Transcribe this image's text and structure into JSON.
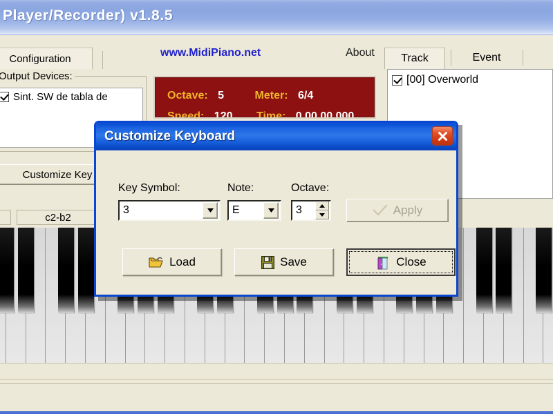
{
  "main_window": {
    "title": "Player/Recorder) v1.8.5",
    "tabs": [
      {
        "label": "Configuration",
        "selected": true
      }
    ],
    "weblink": "www.MidiPiano.net",
    "about_label": "About",
    "output_devices": {
      "group_title": "Output Devices:",
      "items": [
        {
          "label": "Sint. SW de tabla de",
          "checked": true
        }
      ]
    },
    "customize_key_button": "Customize Key",
    "lcd": {
      "octave_label": "Octave:",
      "octave_value": "5",
      "meter_label": "Meter:",
      "meter_value": "6/4",
      "speed_label": "Speed:",
      "speed_value": "120",
      "time_label": "Time:",
      "time_value": "0.00.00.000"
    },
    "right_panel": {
      "tabs": [
        {
          "label": "Track",
          "selected": true
        },
        {
          "label": "Event",
          "selected": false
        }
      ],
      "track_items": [
        {
          "label": "[00] Overworld",
          "checked": true
        }
      ]
    },
    "keyboard_labels": [
      {
        "label": "c2-b2"
      }
    ]
  },
  "dialog": {
    "title": "Customize Keyboard",
    "close_icon": "close-x-icon",
    "fields": [
      {
        "name": "key_symbol",
        "label": "Key Symbol:",
        "value": "3",
        "type": "combobox"
      },
      {
        "name": "note",
        "label": "Note:",
        "value": "E",
        "type": "combobox"
      },
      {
        "name": "octave",
        "label": "Octave:",
        "value": "3",
        "type": "spinner"
      }
    ],
    "apply_button": {
      "label": "Apply",
      "enabled": false,
      "icon": "checkmark-icon"
    },
    "buttons": [
      {
        "name": "load",
        "label": "Load",
        "icon": "open-folder-icon",
        "default": false
      },
      {
        "name": "save",
        "label": "Save",
        "icon": "floppy-disk-icon",
        "default": false
      },
      {
        "name": "close",
        "label": "Close",
        "icon": "exit-door-icon",
        "default": true
      }
    ]
  },
  "colors": {
    "dialog_titlebar": "#1b63e0",
    "main_titlebar": "#8aa5e0",
    "lcd_background": "#8d1111",
    "lcd_label": "#f0b429",
    "lcd_value": "#ffffff",
    "link": "#2222cc",
    "face": "#ece9d8",
    "close_button": "#cf3a14"
  }
}
